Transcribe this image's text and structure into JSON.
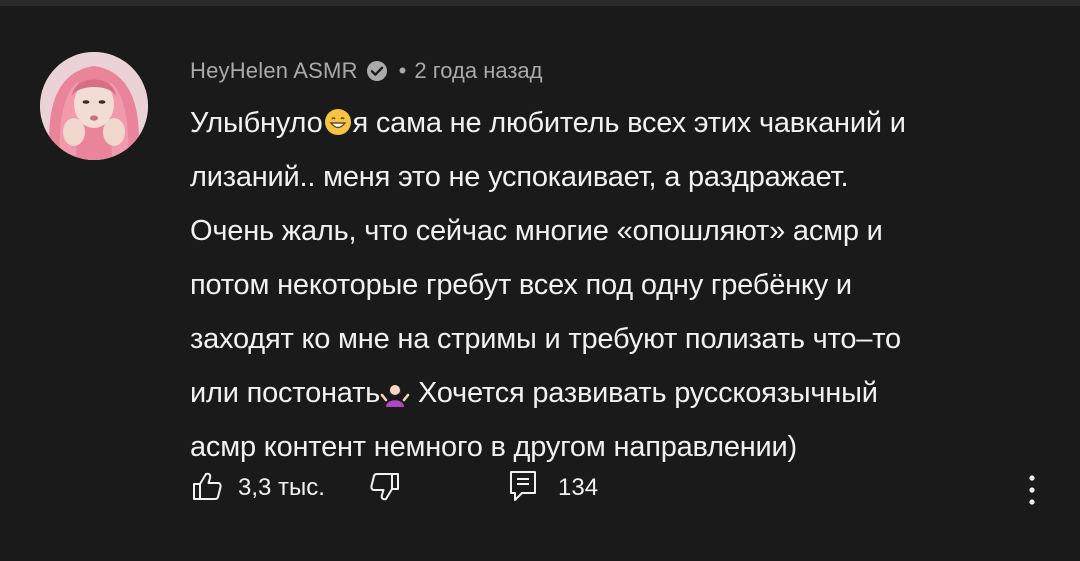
{
  "comment": {
    "author": "HeyHelen ASMR",
    "separator": "•",
    "time": "2 года назад",
    "verified_icon": "verified-check-icon",
    "lines": [
      {
        "before": "Улыбнуло",
        "emoji": "grinning-face-emoji",
        "after": "я сама не любитель всех этих чавканий и"
      },
      {
        "text": "лизаний.. меня это не успокаивает, а раздражает."
      },
      {
        "text": "Очень жаль, что сейчас многие «опошляют» асмр и"
      },
      {
        "text": "потом некоторые гребут всех под одну гребёнку и"
      },
      {
        "text": "заходят ко мне на стримы и требуют полизать что–то"
      },
      {
        "before": "или постонать",
        "emoji": "person-shrugging-emoji",
        "after": " Хочется развивать русскоязычный"
      },
      {
        "text": "асмр контент немного в другом направлении)"
      }
    ],
    "likes": "3,3 тыс.",
    "replies": "134"
  },
  "icons": {
    "like": "thumbs-up-icon",
    "dislike": "thumbs-down-icon",
    "reply": "reply-comment-icon",
    "more": "more-vertical-icon"
  },
  "colors": {
    "background": "#1a1a1a",
    "text_primary": "#f1f1f1",
    "text_secondary": "#aaaaaa"
  }
}
